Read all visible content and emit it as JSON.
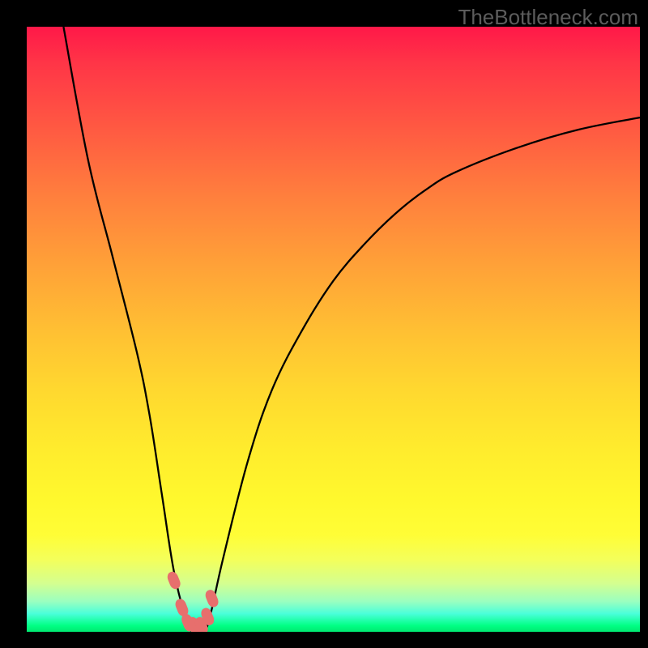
{
  "watermark": "TheBottleneck.com",
  "chart_data": {
    "type": "line",
    "title": "",
    "xlabel": "",
    "ylabel": "",
    "xlim": [
      0,
      100
    ],
    "ylim": [
      0,
      100
    ],
    "series": [
      {
        "name": "bottleneck-curve",
        "x": [
          6,
          10,
          14,
          18,
          20,
          22,
          24,
          26,
          27,
          28,
          29,
          30,
          32,
          36,
          40,
          45,
          50,
          55,
          60,
          65,
          70,
          80,
          90,
          100
        ],
        "values": [
          100,
          78,
          62,
          46,
          36,
          23,
          10,
          2,
          0,
          0,
          0,
          3,
          12,
          28,
          40,
          50,
          58,
          64,
          69,
          73,
          76,
          80,
          83,
          85
        ]
      }
    ],
    "markers": {
      "name": "highlight-dots",
      "x": [
        24.0,
        25.3,
        26.3,
        27.3,
        28.5,
        29.5,
        30.2
      ],
      "values": [
        8.5,
        4.0,
        1.5,
        1.0,
        1.0,
        2.5,
        5.5
      ]
    },
    "notes": "Values are approximate readings from a chart with no visible axis scales; x and y normalized to 0–100 based on plot-area extents. Curve minimum is near x≈27."
  }
}
